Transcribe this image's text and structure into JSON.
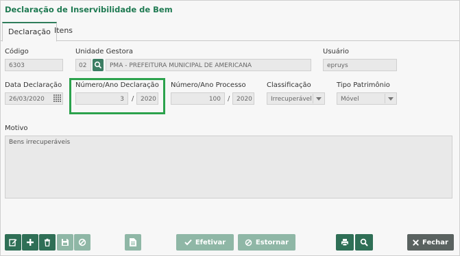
{
  "window": {
    "title": "Declaração de Inservibilidade de Bem"
  },
  "tabs": [
    {
      "label": "Declaração"
    },
    {
      "label": "Itens"
    }
  ],
  "form": {
    "codigo": {
      "label": "Código",
      "value": "6303"
    },
    "unidade_gestora": {
      "label": "Unidade Gestora",
      "code": "02",
      "name": "PMA - PREFEITURA MUNICIPAL DE AMERICANA"
    },
    "usuario": {
      "label": "Usuário",
      "value": "epruys"
    },
    "data_declaracao": {
      "label": "Data Declaração",
      "value": "26/03/2020"
    },
    "numero_ano_declaracao": {
      "label": "Número/Ano Declaração",
      "numero": "3",
      "separator": "/",
      "ano": "2020"
    },
    "numero_ano_processo": {
      "label": "Número/Ano Processo",
      "numero": "100",
      "separator": "/",
      "ano": "2020"
    },
    "classificacao": {
      "label": "Classificação",
      "value": "Irrecuperável"
    },
    "tipo_patrimonio": {
      "label": "Tipo Patrimônio",
      "value": "Móvel"
    },
    "motivo": {
      "label": "Motivo",
      "value": "Bens irrecuperáveis"
    }
  },
  "toolbar": {
    "efetivar_label": "Efetivar",
    "estornar_label": "Estornar",
    "fechar_label": "Fechar"
  },
  "colors": {
    "title": "#1f7a52",
    "button_dark": "#2f6f56",
    "button_disabled": "#8fb7a6",
    "highlight": "#2ba24c",
    "close_button": "#5a6260"
  }
}
